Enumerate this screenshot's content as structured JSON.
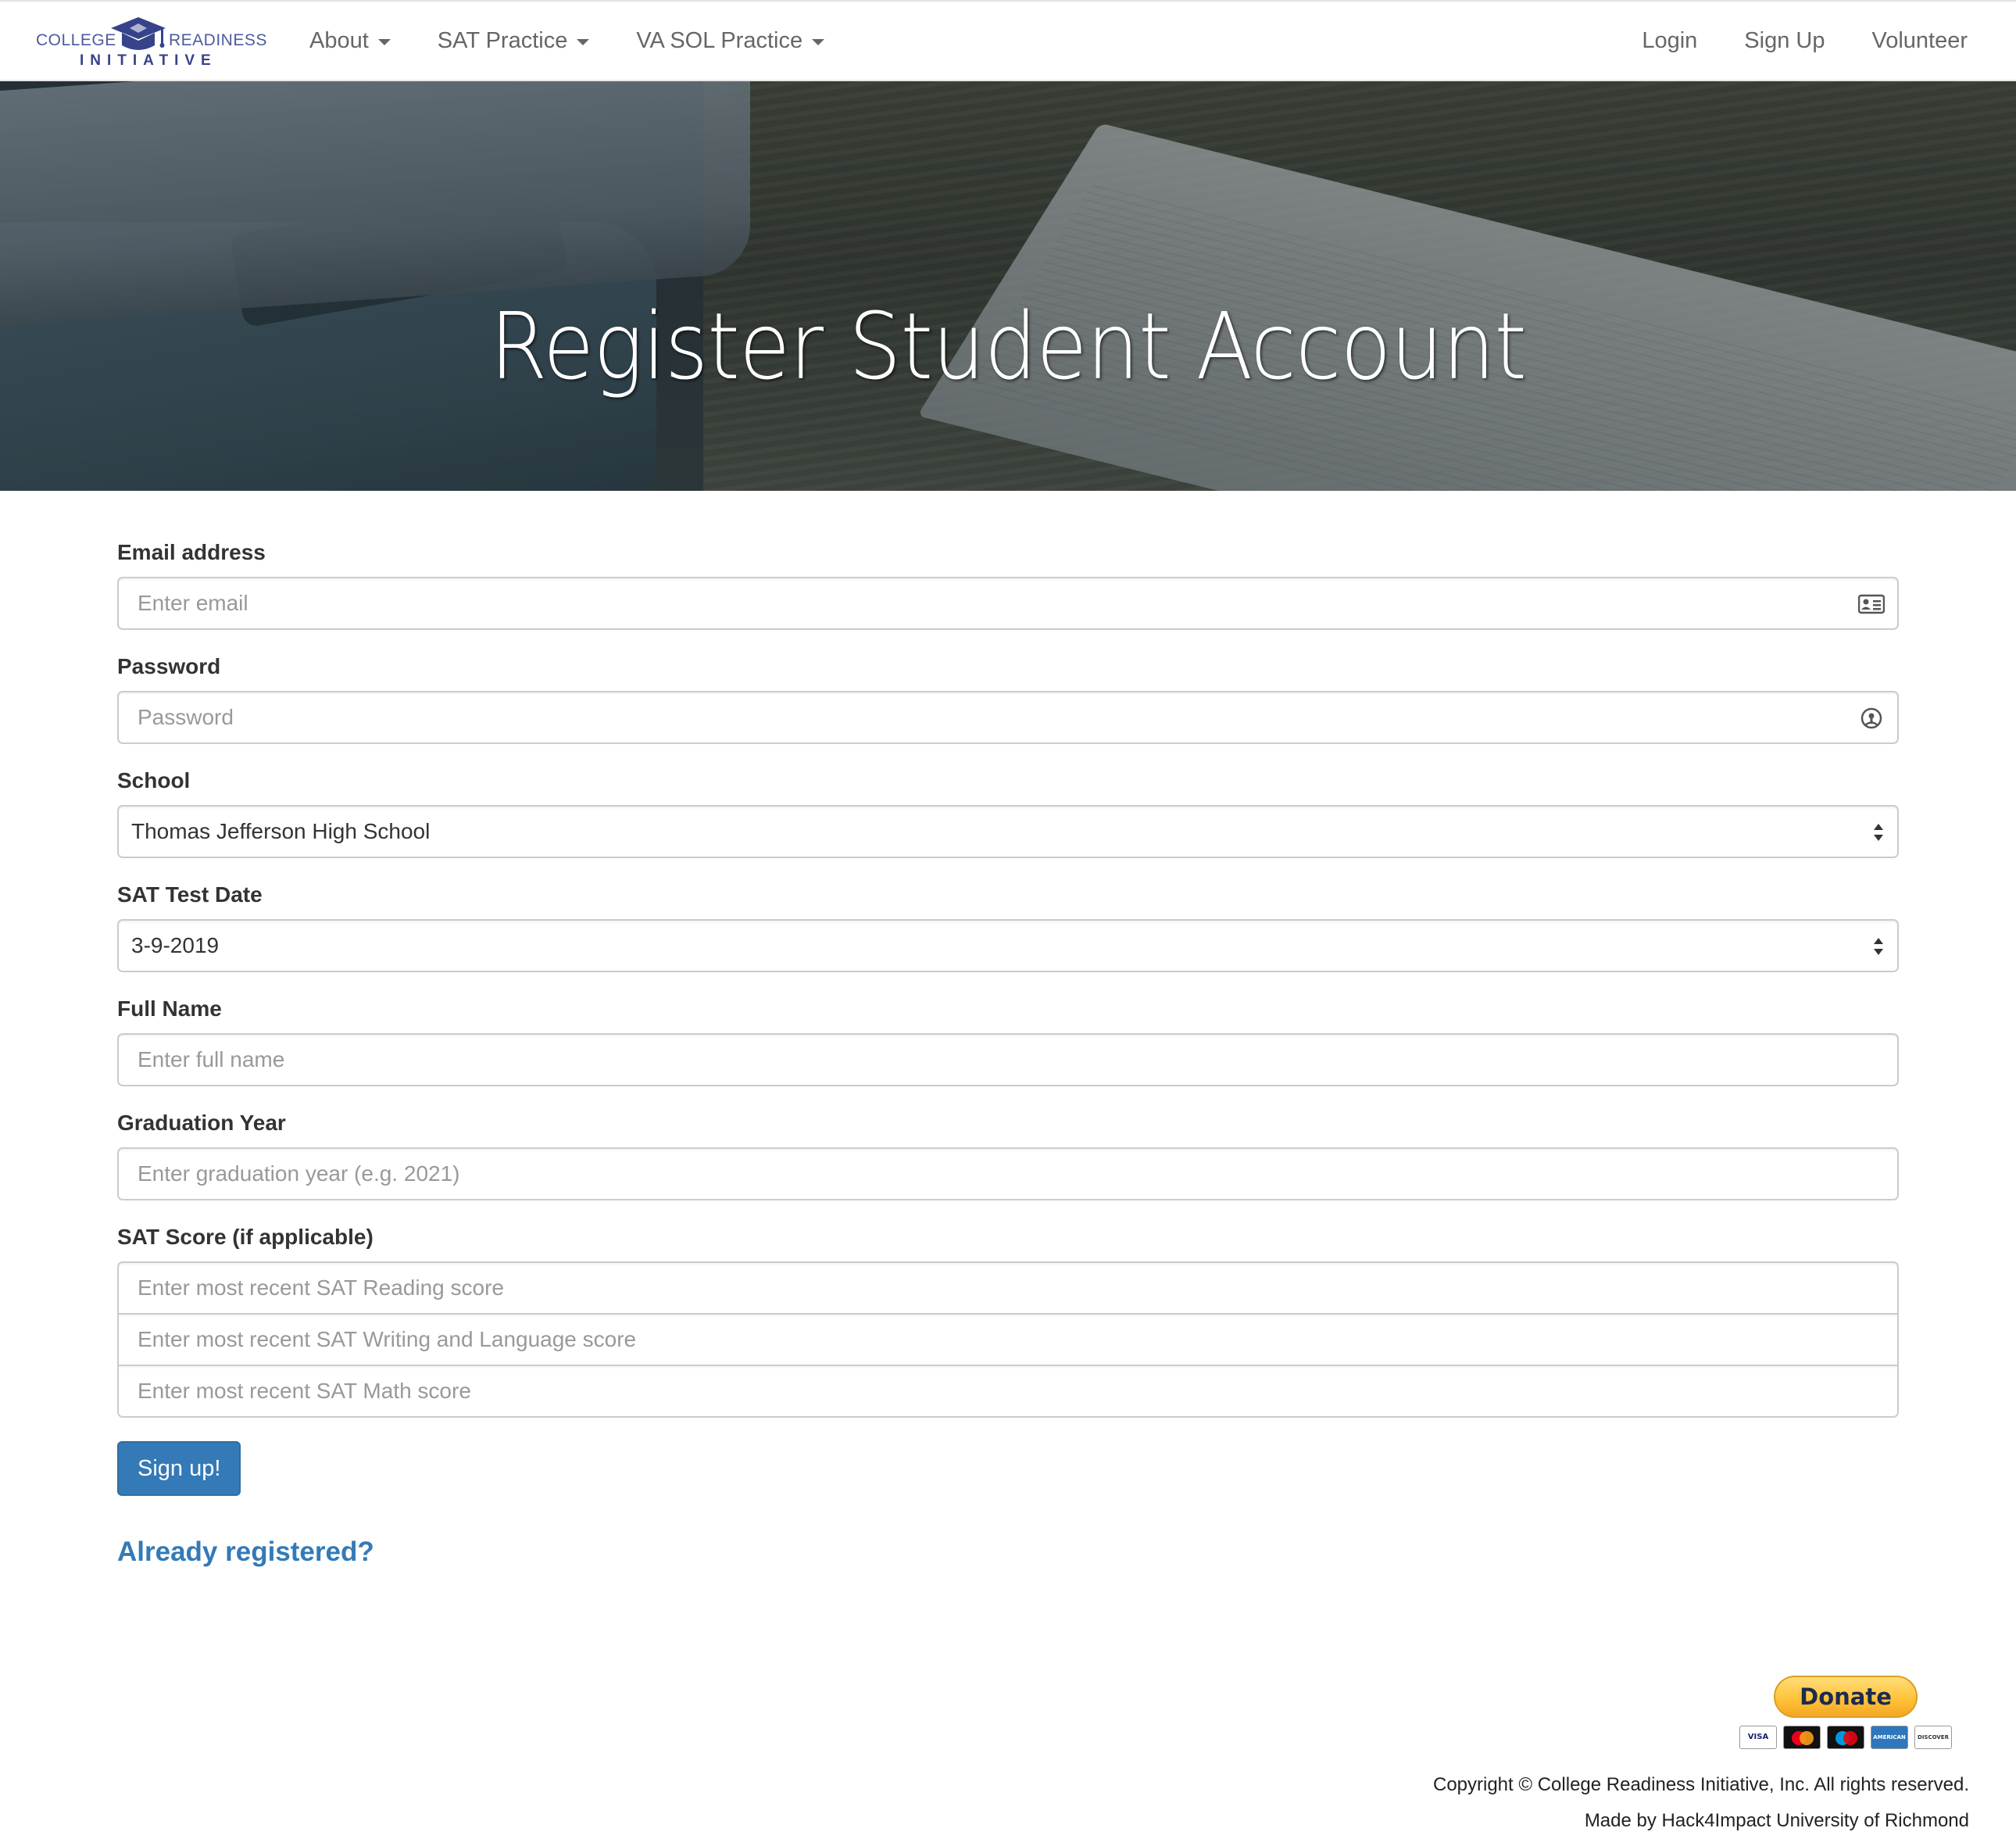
{
  "nav": {
    "logo": {
      "left_word": "COLLEGE",
      "right_word": "READINESS",
      "bottom_word": "INITIATIVE"
    },
    "left_items": [
      {
        "label": "About"
      },
      {
        "label": "SAT Practice"
      },
      {
        "label": "VA SOL Practice"
      }
    ],
    "right_items": [
      {
        "label": "Login"
      },
      {
        "label": "Sign Up"
      },
      {
        "label": "Volunteer"
      }
    ]
  },
  "hero": {
    "title": "Register Student Account"
  },
  "form": {
    "email": {
      "label": "Email address",
      "placeholder": "Enter email",
      "icon": "contact-card-icon"
    },
    "password": {
      "label": "Password",
      "placeholder": "Password",
      "icon": "password-key-icon"
    },
    "school": {
      "label": "School",
      "value": "Thomas Jefferson High School"
    },
    "test_date": {
      "label": "SAT Test Date",
      "value": "3-9-2019"
    },
    "full_name": {
      "label": "Full Name",
      "placeholder": "Enter full name"
    },
    "grad_year": {
      "label": "Graduation Year",
      "placeholder": "Enter graduation year (e.g. 2021)"
    },
    "sat_score": {
      "label": "SAT Score (if applicable)",
      "reading_placeholder": "Enter most recent SAT Reading score",
      "writing_placeholder": "Enter most recent SAT Writing and Language score",
      "math_placeholder": "Enter most recent SAT Math score"
    },
    "submit_label": "Sign up!",
    "already_registered": "Already registered?"
  },
  "footer": {
    "donate_label": "Donate",
    "cards": [
      "VISA",
      "mastercard",
      "maestro",
      "AMERICAN EXPRESS",
      "DISCOVER"
    ],
    "copyright": "Copyright © College Readiness Initiative, Inc. All rights reserved.",
    "made_by": "Made by Hack4Impact University of Richmond"
  },
  "colors": {
    "primary": "#337ab7",
    "nav_text": "#666666",
    "donate": "#ffc439"
  }
}
